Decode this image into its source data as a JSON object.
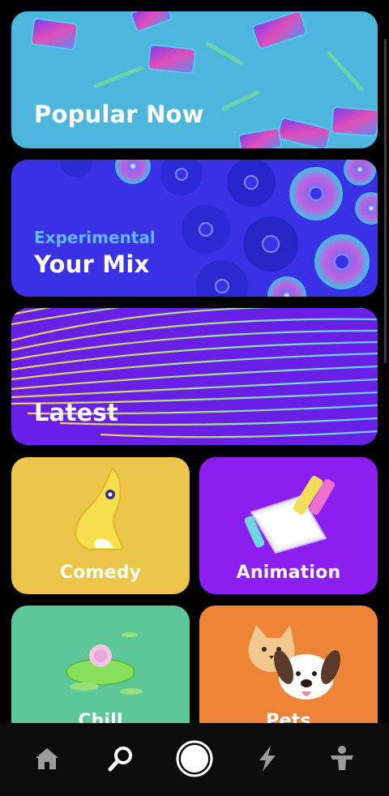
{
  "cards": {
    "popular": {
      "title": "Popular Now"
    },
    "mix": {
      "subtitle": "Experimental",
      "title": "Your Mix"
    },
    "latest": {
      "title": "Latest"
    },
    "comedy": {
      "title": "Comedy"
    },
    "animation": {
      "title": "Animation"
    },
    "chill": {
      "title": "Chill"
    },
    "pets": {
      "title": "Pets"
    }
  },
  "nav": [
    "home-icon",
    "search-icon",
    "record-icon",
    "lightning-icon",
    "profile-icon"
  ],
  "colors": {
    "popular_bg": "#4cb6dc",
    "mix_bg": "#3a30e6",
    "latest_bg": "#6a1fe8",
    "comedy_bg": "#ecc64a",
    "animation_bg": "#8c1ef0",
    "chill_bg": "#5cc89a",
    "pets_bg": "#ee8436",
    "subtitle_accent": "#66b8ff"
  }
}
